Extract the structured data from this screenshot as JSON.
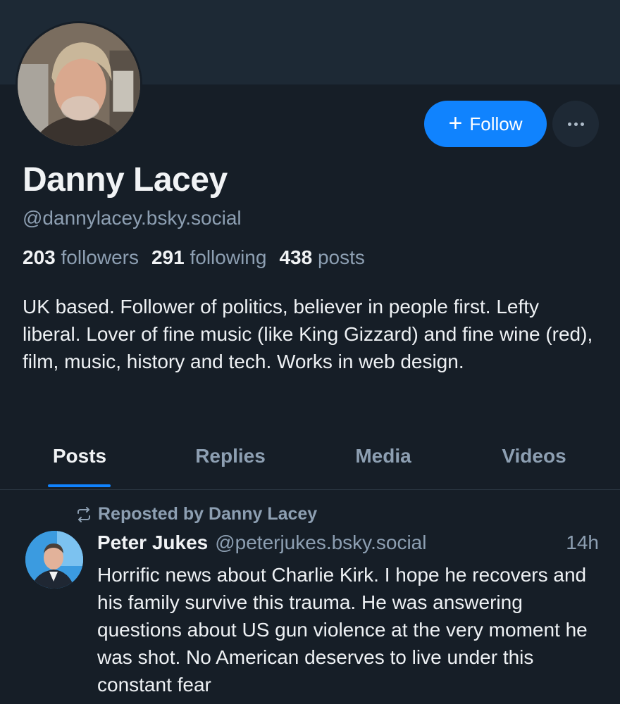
{
  "profile": {
    "display_name": "Danny Lacey",
    "handle": "@dannylacey.bsky.social",
    "followers_count": "203",
    "followers_label": "followers",
    "following_count": "291",
    "following_label": "following",
    "posts_count": "438",
    "posts_label": "posts",
    "bio": "UK based. Follower of politics, believer in people first. Lefty liberal. Lover of fine music (like King Gizzard) and fine wine (red), film, music, history and tech. Works in web design."
  },
  "actions": {
    "follow_icon": "plus-icon",
    "follow_label": "Follow",
    "more_icon": "ellipsis-icon"
  },
  "tabs": [
    {
      "label": "Posts",
      "active": true
    },
    {
      "label": "Replies",
      "active": false
    },
    {
      "label": "Media",
      "active": false
    },
    {
      "label": "Videos",
      "active": false
    }
  ],
  "feed": {
    "post": {
      "repost_icon": "repost-icon",
      "repost_label": "Reposted by Danny Lacey",
      "author_name": "Peter Jukes",
      "author_handle": "@peterjukes.bsky.social",
      "time": "14h",
      "text": "Horrific news about Charlie Kirk. I hope he recovers and his family survive this trauma. He was answering  questions about US gun violence at the very moment he was shot. No American deserves to live under this constant fear"
    }
  },
  "colors": {
    "background": "#161e27",
    "banner": "#1d2935",
    "accent": "#1083fe",
    "muted_text": "#8d9fb2"
  }
}
